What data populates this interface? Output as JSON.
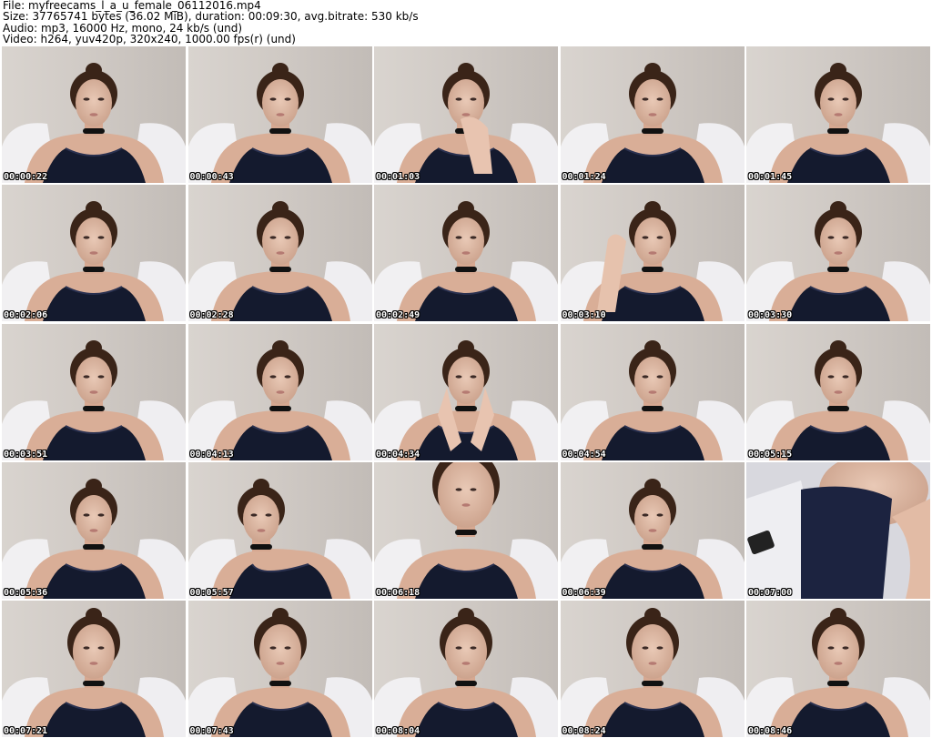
{
  "header": {
    "file_line": "File: myfreecams_l_a_u_female_06112016.mp4",
    "size_line": "Size: 37765741 bytes (36.02 MiB), duration: 00:09:30, avg.bitrate: 530 kb/s",
    "audio_line": "Audio: mp3, 16000 Hz, mono, 24 kb/s (und)",
    "video_line": "Video: h264, yuv420p, 320x240, 1000.00 fps(r) (und)"
  },
  "colors": {
    "background": "#ffffff",
    "timestamp_text": "#ffffff",
    "timestamp_outline": "#000000"
  },
  "frames": [
    {
      "timestamp": "00:00:22"
    },
    {
      "timestamp": "00:00:43"
    },
    {
      "timestamp": "00:01:03"
    },
    {
      "timestamp": "00:01:24"
    },
    {
      "timestamp": "00:01:45"
    },
    {
      "timestamp": "00:02:06"
    },
    {
      "timestamp": "00:02:28"
    },
    {
      "timestamp": "00:02:49"
    },
    {
      "timestamp": "00:03:10"
    },
    {
      "timestamp": "00:03:30"
    },
    {
      "timestamp": "00:03:51"
    },
    {
      "timestamp": "00:04:13"
    },
    {
      "timestamp": "00:04:34"
    },
    {
      "timestamp": "00:04:54"
    },
    {
      "timestamp": "00:05:15"
    },
    {
      "timestamp": "00:05:36"
    },
    {
      "timestamp": "00:05:57"
    },
    {
      "timestamp": "00:06:18"
    },
    {
      "timestamp": "00:06:39"
    },
    {
      "timestamp": "00:07:00"
    },
    {
      "timestamp": "00:07:21"
    },
    {
      "timestamp": "00:07:43"
    },
    {
      "timestamp": "00:08:04"
    },
    {
      "timestamp": "00:08:24"
    },
    {
      "timestamp": "00:08:46"
    }
  ]
}
